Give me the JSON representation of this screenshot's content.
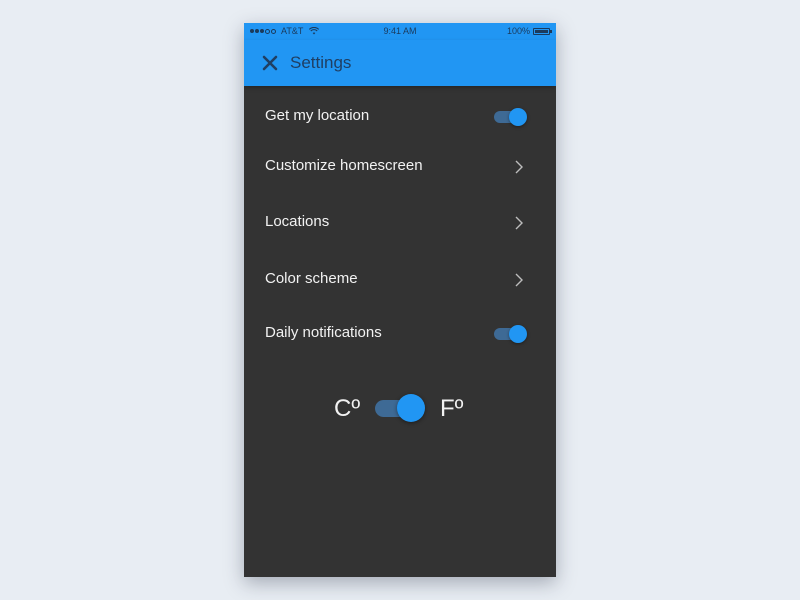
{
  "status_bar": {
    "carrier": "AT&T",
    "time": "9:41 AM",
    "battery": "100%",
    "signal_bars_filled": 3,
    "signal_bars_total": 5
  },
  "app_bar": {
    "close_icon": "close-icon",
    "title": "Settings"
  },
  "settings": {
    "items": [
      {
        "label": "Get my location",
        "control": "toggle",
        "on": true
      },
      {
        "label": "Customize homescreen",
        "control": "chevron-right-icon"
      },
      {
        "label": "Locations",
        "control": "chevron-right-icon"
      },
      {
        "label": "Color scheme",
        "control": "chevron-right-icon"
      },
      {
        "label": "Daily notifications",
        "control": "toggle",
        "on": true
      }
    ]
  },
  "units": {
    "celsius_label": "Cº",
    "fahrenheit_label": "Fº",
    "selected": "fahrenheit"
  },
  "colors": {
    "accent": "#2196f3",
    "background": "#333333",
    "toggle_track": "#3e6a95",
    "page_background": "#e8edf3"
  }
}
